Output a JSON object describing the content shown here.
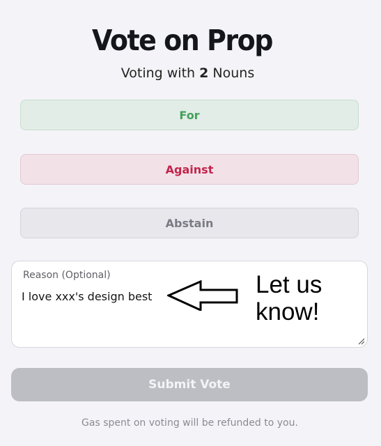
{
  "header": {
    "title": "Vote on Prop",
    "subtitle_prefix": "Voting with",
    "vote_count": "2",
    "subtitle_suffix": "Nouns"
  },
  "options": {
    "for": "For",
    "against": "Against",
    "abstain": "Abstain"
  },
  "reason": {
    "label": "Reason (Optional)",
    "value": "I love xxx's design best",
    "annotation_line1": "Let us",
    "annotation_line2": "know!"
  },
  "submit": {
    "label": "Submit Vote"
  },
  "footer": {
    "note": "Gas spent on voting will be refunded to you."
  },
  "colors": {
    "for_text": "#43a05c",
    "against_text": "#c2254b",
    "abstain_text": "#7b7b85",
    "submit_bg": "#bdbec3"
  },
  "icons": {
    "arrow": "left-arrow-icon",
    "resize": "resize-handle-icon"
  }
}
